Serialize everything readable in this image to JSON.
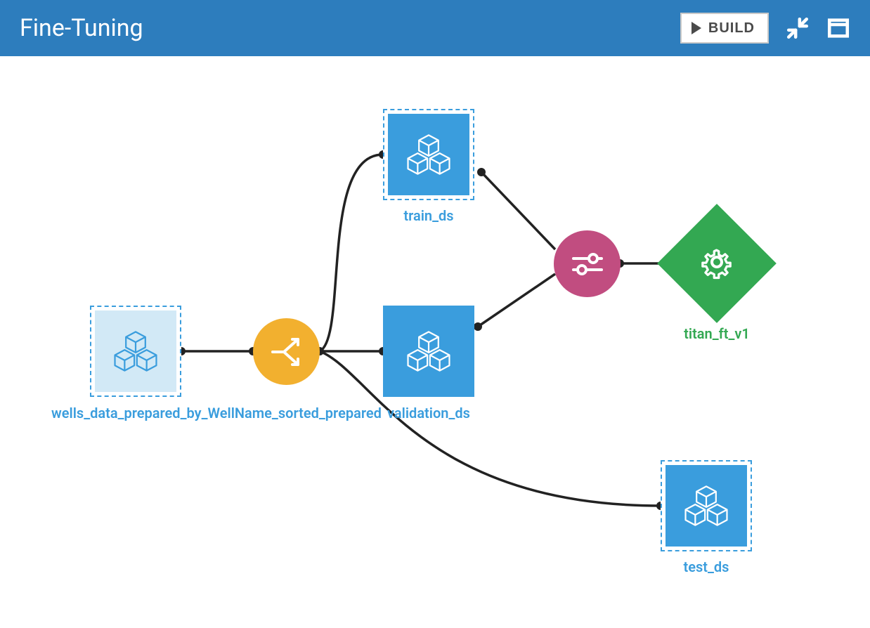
{
  "header": {
    "title": "Fine-Tuning",
    "build_label": "BUILD"
  },
  "nodes": {
    "source": {
      "label": "wells_data_prepared_by_WellName_sorted_prepared",
      "color": "#3a9ddd"
    },
    "train": {
      "label": "train_ds",
      "color": "#3a9ddd"
    },
    "validation": {
      "label": "validation_ds",
      "color": "#3a9ddd"
    },
    "test": {
      "label": "test_ds",
      "color": "#3a9ddd"
    },
    "model": {
      "label": "titan_ft_v1",
      "color": "#33a852"
    }
  },
  "palette": {
    "header_bg": "#2d7dbd",
    "dataset_blue": "#3a9ddd",
    "dataset_light": "#d2e9f6",
    "split_yellow": "#f2b02f",
    "recipe_pink": "#c14d80",
    "model_green": "#33a852",
    "edge": "#222222"
  }
}
